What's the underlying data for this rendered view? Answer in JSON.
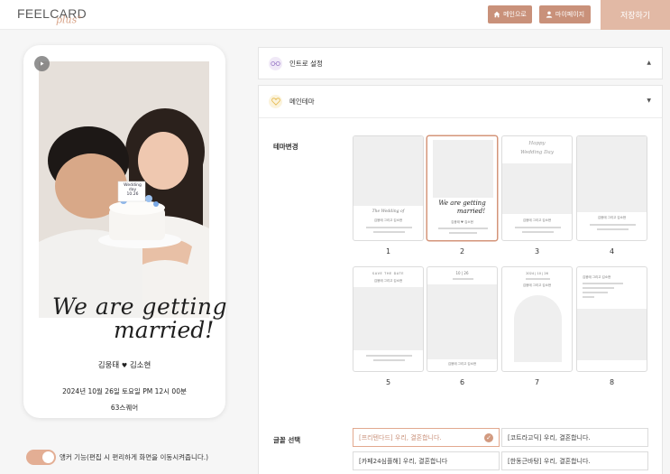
{
  "header": {
    "logo_main": "FEELCARD",
    "logo_plus": "plus",
    "home_label": "메인으로",
    "mypage_label": "마이페이지",
    "save_label": "저장하기",
    "accent_color": "#c9917a"
  },
  "preview": {
    "title_line1": "We are getting",
    "title_line2": "married!",
    "groom": "김웅태",
    "bride": "김소현",
    "heart": "♥",
    "date_line": "2024년 10월 26일 토요일 PM 12시 00분",
    "venue": "63스퀘어",
    "cake_text_1": "Wedding",
    "cake_text_2": "day",
    "cake_text_3": "10.26"
  },
  "anchor_toggle": {
    "on": true,
    "label": "앵커 기능(편집 시 편리하게 화면을 이동시켜줍니다.)"
  },
  "sections": {
    "intro": {
      "title": "인트로 설정",
      "arrow": "▲"
    },
    "main_theme": {
      "title": "메인테마",
      "arrow": "▼"
    }
  },
  "theme": {
    "label": "테마변경",
    "selected": 2,
    "items": [
      {
        "number": "1",
        "script": "The Wedding of",
        "names": "김웅태 그리고 김소현"
      },
      {
        "number": "2",
        "script_line1": "We are getting",
        "script_line2": "married!",
        "names": "김웅태 ♥ 김소현"
      },
      {
        "number": "3",
        "script_line1": "Happy",
        "script_line2": "Wedding Day",
        "names": "김웅태 그리고 김소현"
      },
      {
        "number": "4",
        "names": "김웅태 그리고 김소현"
      },
      {
        "number": "5",
        "header": "SAVE THE DATE",
        "names": "김웅태 그리고 김소현"
      },
      {
        "number": "6",
        "header": "10 | 26",
        "names": "김웅태 그리고 김소현"
      },
      {
        "number": "7",
        "header": "2024 | 10 | 26",
        "names": "김웅태 그리고 김소현"
      },
      {
        "number": "8",
        "names": "김웅태 그리고 김소현"
      }
    ]
  },
  "fonts": {
    "label": "글꼴 선택",
    "options": [
      {
        "label": "[프리텐다드] 우리, 결혼합니다.",
        "selected": true
      },
      {
        "label": "[코트라고딕] 우리, 결혼합니다.",
        "selected": false
      },
      {
        "label": "[카페24심플해] 우리, 결혼합니다",
        "selected": false
      },
      {
        "label": "[한동근바탕] 우리, 결혼합니다.",
        "selected": false
      }
    ]
  }
}
